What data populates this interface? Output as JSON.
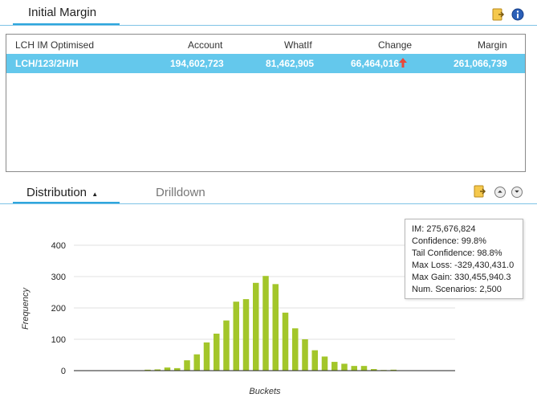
{
  "header": {
    "title": "Initial Margin"
  },
  "grid": {
    "columns": [
      "LCH IM Optimised",
      "Account",
      "WhatIf",
      "Change",
      "Margin"
    ],
    "rows": [
      {
        "name": "LCH/123/2H/H",
        "account": "194,602,723",
        "whatif": "81,462,905",
        "change": "66,464,016",
        "margin": "261,066,739",
        "change_direction": "up"
      }
    ]
  },
  "tabs": {
    "distribution": "Distribution",
    "drilldown": "Drilldown"
  },
  "tooltip": {
    "im": "IM: 275,676,824",
    "confidence": "Confidence: 99.8%",
    "tail_confidence": "Tail Confidence: 98.8%",
    "max_loss": "Max Loss: -329,430,431.0",
    "max_gain": "Max Gain: 330,455,940.3",
    "scenarios": "Num. Scenarios: 2,500"
  },
  "colors": {
    "accent": "#2ea6dd",
    "row_selected": "#64c8ec",
    "bar": "#a3c62a",
    "arrow": "#e8483a"
  },
  "icons": {
    "export": "export-icon",
    "info": "info-icon",
    "collapse": "collapse-up-icon",
    "expand": "expand-down-icon"
  },
  "chart_data": {
    "type": "bar",
    "xlabel": "Buckets",
    "ylabel": "Frequency",
    "ylim": [
      0,
      400
    ],
    "yticks": [
      "0",
      "100",
      "200",
      "300",
      "400"
    ],
    "values": [
      0,
      0,
      0,
      0,
      0,
      0,
      0,
      3,
      4,
      10,
      8,
      33,
      52,
      90,
      118,
      160,
      220,
      228,
      280,
      302,
      276,
      185,
      135,
      100,
      65,
      45,
      28,
      22,
      15,
      15,
      5,
      2,
      3,
      0,
      0,
      0,
      0,
      0,
      0
    ],
    "grid": true
  }
}
